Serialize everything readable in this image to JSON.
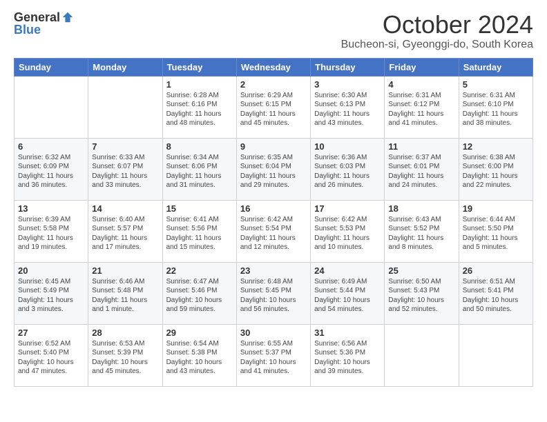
{
  "header": {
    "logo_general": "General",
    "logo_blue": "Blue",
    "month_title": "October 2024",
    "subtitle": "Bucheon-si, Gyeonggi-do, South Korea"
  },
  "days_of_week": [
    "Sunday",
    "Monday",
    "Tuesday",
    "Wednesday",
    "Thursday",
    "Friday",
    "Saturday"
  ],
  "weeks": [
    [
      {
        "day": "",
        "info": ""
      },
      {
        "day": "",
        "info": ""
      },
      {
        "day": "1",
        "info": "Sunrise: 6:28 AM\nSunset: 6:16 PM\nDaylight: 11 hours and 48 minutes."
      },
      {
        "day": "2",
        "info": "Sunrise: 6:29 AM\nSunset: 6:15 PM\nDaylight: 11 hours and 45 minutes."
      },
      {
        "day": "3",
        "info": "Sunrise: 6:30 AM\nSunset: 6:13 PM\nDaylight: 11 hours and 43 minutes."
      },
      {
        "day": "4",
        "info": "Sunrise: 6:31 AM\nSunset: 6:12 PM\nDaylight: 11 hours and 41 minutes."
      },
      {
        "day": "5",
        "info": "Sunrise: 6:31 AM\nSunset: 6:10 PM\nDaylight: 11 hours and 38 minutes."
      }
    ],
    [
      {
        "day": "6",
        "info": "Sunrise: 6:32 AM\nSunset: 6:09 PM\nDaylight: 11 hours and 36 minutes."
      },
      {
        "day": "7",
        "info": "Sunrise: 6:33 AM\nSunset: 6:07 PM\nDaylight: 11 hours and 33 minutes."
      },
      {
        "day": "8",
        "info": "Sunrise: 6:34 AM\nSunset: 6:06 PM\nDaylight: 11 hours and 31 minutes."
      },
      {
        "day": "9",
        "info": "Sunrise: 6:35 AM\nSunset: 6:04 PM\nDaylight: 11 hours and 29 minutes."
      },
      {
        "day": "10",
        "info": "Sunrise: 6:36 AM\nSunset: 6:03 PM\nDaylight: 11 hours and 26 minutes."
      },
      {
        "day": "11",
        "info": "Sunrise: 6:37 AM\nSunset: 6:01 PM\nDaylight: 11 hours and 24 minutes."
      },
      {
        "day": "12",
        "info": "Sunrise: 6:38 AM\nSunset: 6:00 PM\nDaylight: 11 hours and 22 minutes."
      }
    ],
    [
      {
        "day": "13",
        "info": "Sunrise: 6:39 AM\nSunset: 5:58 PM\nDaylight: 11 hours and 19 minutes."
      },
      {
        "day": "14",
        "info": "Sunrise: 6:40 AM\nSunset: 5:57 PM\nDaylight: 11 hours and 17 minutes."
      },
      {
        "day": "15",
        "info": "Sunrise: 6:41 AM\nSunset: 5:56 PM\nDaylight: 11 hours and 15 minutes."
      },
      {
        "day": "16",
        "info": "Sunrise: 6:42 AM\nSunset: 5:54 PM\nDaylight: 11 hours and 12 minutes."
      },
      {
        "day": "17",
        "info": "Sunrise: 6:42 AM\nSunset: 5:53 PM\nDaylight: 11 hours and 10 minutes."
      },
      {
        "day": "18",
        "info": "Sunrise: 6:43 AM\nSunset: 5:52 PM\nDaylight: 11 hours and 8 minutes."
      },
      {
        "day": "19",
        "info": "Sunrise: 6:44 AM\nSunset: 5:50 PM\nDaylight: 11 hours and 5 minutes."
      }
    ],
    [
      {
        "day": "20",
        "info": "Sunrise: 6:45 AM\nSunset: 5:49 PM\nDaylight: 11 hours and 3 minutes."
      },
      {
        "day": "21",
        "info": "Sunrise: 6:46 AM\nSunset: 5:48 PM\nDaylight: 11 hours and 1 minute."
      },
      {
        "day": "22",
        "info": "Sunrise: 6:47 AM\nSunset: 5:46 PM\nDaylight: 10 hours and 59 minutes."
      },
      {
        "day": "23",
        "info": "Sunrise: 6:48 AM\nSunset: 5:45 PM\nDaylight: 10 hours and 56 minutes."
      },
      {
        "day": "24",
        "info": "Sunrise: 6:49 AM\nSunset: 5:44 PM\nDaylight: 10 hours and 54 minutes."
      },
      {
        "day": "25",
        "info": "Sunrise: 6:50 AM\nSunset: 5:43 PM\nDaylight: 10 hours and 52 minutes."
      },
      {
        "day": "26",
        "info": "Sunrise: 6:51 AM\nSunset: 5:41 PM\nDaylight: 10 hours and 50 minutes."
      }
    ],
    [
      {
        "day": "27",
        "info": "Sunrise: 6:52 AM\nSunset: 5:40 PM\nDaylight: 10 hours and 47 minutes."
      },
      {
        "day": "28",
        "info": "Sunrise: 6:53 AM\nSunset: 5:39 PM\nDaylight: 10 hours and 45 minutes."
      },
      {
        "day": "29",
        "info": "Sunrise: 6:54 AM\nSunset: 5:38 PM\nDaylight: 10 hours and 43 minutes."
      },
      {
        "day": "30",
        "info": "Sunrise: 6:55 AM\nSunset: 5:37 PM\nDaylight: 10 hours and 41 minutes."
      },
      {
        "day": "31",
        "info": "Sunrise: 6:56 AM\nSunset: 5:36 PM\nDaylight: 10 hours and 39 minutes."
      },
      {
        "day": "",
        "info": ""
      },
      {
        "day": "",
        "info": ""
      }
    ]
  ]
}
